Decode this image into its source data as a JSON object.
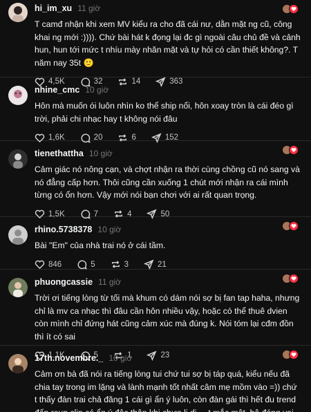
{
  "posts": [
    {
      "username": "hi_im_xu",
      "time": "11 giờ",
      "text": "T camđ nhận khi xem MV kiểu ra cho đã cái nư, dằn mặt ng cũ, công khai ng mới :)))). Chứ bài hát k đọng lại đc gì ngoài câu chủ đề và cảnh hun, hun tới mức t nhíu mày nhăn mặt và tự hỏi có cần thiết không?. T năm nay 35t 🙂",
      "likes": "4,5K",
      "comments": "32",
      "reposts": "14",
      "shares": "363",
      "avatar_color": "#d8c7bd"
    },
    {
      "username": "nhine_cmc",
      "time": "10 giờ",
      "text": "Hôn mà muốn ói luôn nhìn ko thể ship nổi, hôn xoay tròn là cái đéo gì trời, phải chi nhạc hay t không nói đâu",
      "likes": "1,6K",
      "comments": "20",
      "reposts": "6",
      "shares": "152",
      "avatar_color": "#e9e3e6"
    },
    {
      "username": "tienethattha",
      "time": "10 giờ",
      "text": "Cảm giác nó nông cạn, và chợt nhận ra thời cùng chồng cũ nó sang và nó đẳng cấp hơn. Thôi cũng cần xuống 1 chút mới nhận ra cái mình từng có ổn hơn. Vậy mới nói bạn chơi với ai rất quan trọng.",
      "likes": "1,5K",
      "comments": "7",
      "reposts": "4",
      "shares": "50",
      "avatar_color": "#3a3a3a"
    },
    {
      "username": "rhino.5738378",
      "time": "10 giờ",
      "text": "Bài \"Em\" của nhà trai nó ở cái tầm.",
      "likes": "846",
      "comments": "5",
      "reposts": "3",
      "shares": "21",
      "avatar_color": "#d9d9d9"
    },
    {
      "username": "phuongcassie",
      "time": "11 giờ",
      "text": "Trời ơi tiếng lòng từ tối mà khum có dám nói sợ bị fan tap haha, nhưng chỉ là mv ca nhạc thì đâu cần hôn nhiều vậy, hoặc có thể thuê dvien còn mình chỉ đứng hát cũng cảm xúc mà đúng k. Nói tóm lại cđm đồn thì ít có sai",
      "likes": "1,1K",
      "comments": "5",
      "reposts": "1",
      "shares": "23",
      "avatar_color": "#7b8a6a"
    },
    {
      "username": "17th.novembre._",
      "time": "10 giờ",
      "text": "Cảm ơn bà đã nói ra tiếng lòng tui chứ tui sợ bị táp quá, kiểu nếu đã chia tay trong im lặng và lành mạnh tốt nhất câm mẹ mồm vào =)) chứ t thấy đàn trai chả đăng 1 cái gì ẩn ý luôn, còn đàn gái thì hết đu trend đến reup clip có ẩn ý độc thân khi chưa li dị,... t mắc mệt, bộ đóng vai nạn nhân hay gì :)))",
      "likes": "",
      "comments": "",
      "reposts": "",
      "shares": "",
      "avatar_color": "#b08a6c"
    }
  ]
}
